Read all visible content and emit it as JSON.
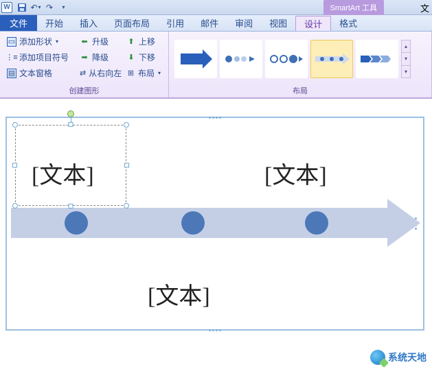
{
  "titlebar": {
    "app_icon": "W",
    "contextual_title": "SmartArt 工具",
    "doc_right": "文"
  },
  "tabs": {
    "file": "文件",
    "items": [
      "开始",
      "插入",
      "页面布局",
      "引用",
      "邮件",
      "审阅",
      "视图",
      "设计",
      "格式"
    ],
    "active_index": 7
  },
  "ribbon": {
    "group_create": {
      "label": "创建图形",
      "add_shape": "添加形状",
      "add_bullet": "添加项目符号",
      "text_pane": "文本窗格",
      "promote": "升级",
      "demote": "降级",
      "rtl": "从右向左",
      "move_up": "上移",
      "move_down": "下移",
      "layout_btn": "布局"
    },
    "group_layout": {
      "label": "布局"
    }
  },
  "smartart": {
    "placeholders": [
      "[文本]",
      "[文本]",
      "[文本]"
    ]
  },
  "watermark": {
    "text": "系统天地"
  }
}
